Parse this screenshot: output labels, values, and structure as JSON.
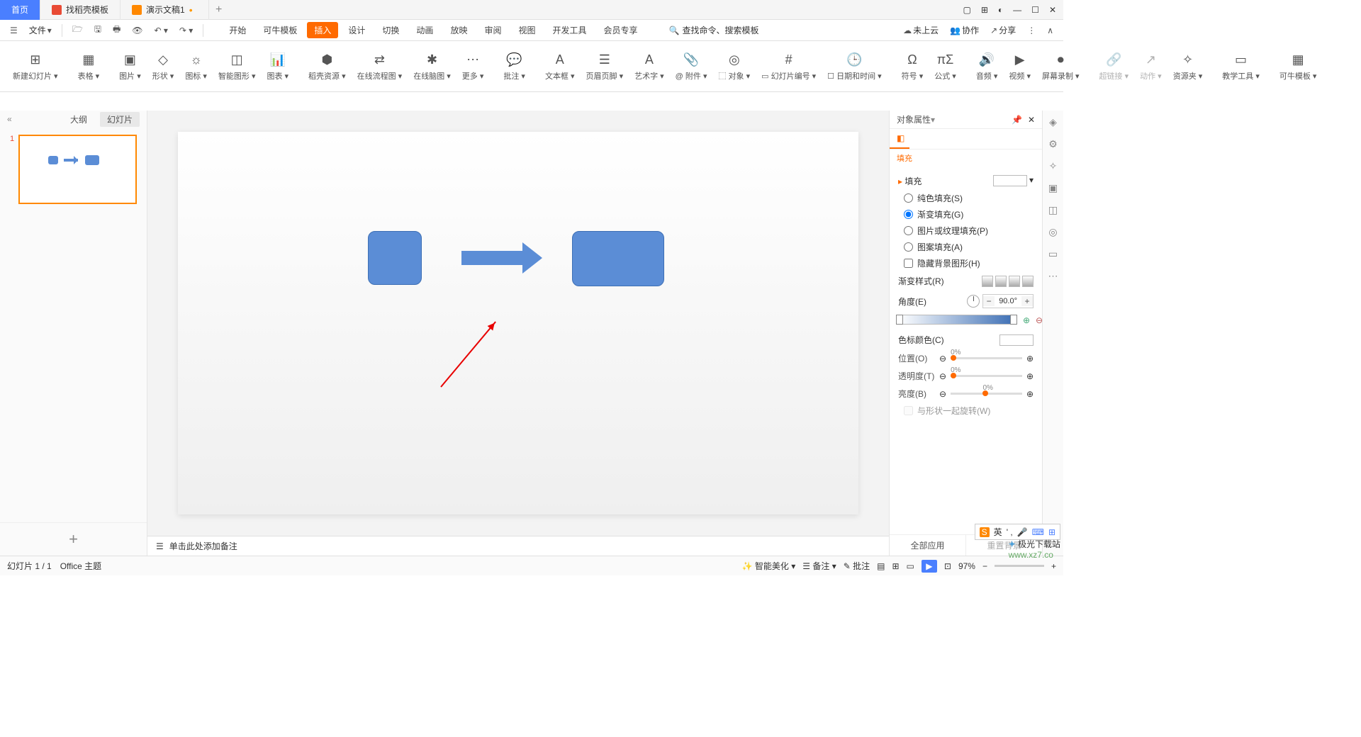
{
  "tabs": {
    "home": "首页",
    "templates": "找稻壳模板",
    "doc": "演示文稿1"
  },
  "topbar": {
    "file": "文件"
  },
  "menu": [
    "开始",
    "可牛模板",
    "插入",
    "设计",
    "切换",
    "动画",
    "放映",
    "审阅",
    "视图",
    "开发工具",
    "会员专享"
  ],
  "menu_active_index": 2,
  "search_placeholder": "查找命令、搜索模板",
  "ribbon": [
    {
      "label": "新建幻灯片",
      "icon": "⊞"
    },
    {
      "label": "表格",
      "icon": "▦"
    },
    {
      "label": "图片",
      "icon": "▣"
    },
    {
      "label": "形状",
      "icon": "◇"
    },
    {
      "label": "图标",
      "icon": "☼"
    },
    {
      "label": "智能图形",
      "icon": "◫"
    },
    {
      "label": "图表",
      "icon": "📊"
    },
    {
      "label": "稻壳资源",
      "icon": "⬢"
    },
    {
      "label": "在线流程图",
      "icon": "⇄"
    },
    {
      "label": "在线脑图",
      "icon": "✱"
    },
    {
      "label": "更多",
      "icon": "⋯"
    },
    {
      "label": "批注",
      "icon": "💬"
    },
    {
      "label": "文本框",
      "icon": "A"
    },
    {
      "label": "页眉页脚",
      "icon": "☰"
    },
    {
      "label": "艺术字",
      "icon": "A"
    },
    {
      "label": "附件",
      "icon": "📎",
      "prefix": "@"
    },
    {
      "label": "对象",
      "icon": "◎",
      "prefix": "⬚"
    },
    {
      "label": "幻灯片编号",
      "icon": "#",
      "prefix": "▭"
    },
    {
      "label": "日期和时间",
      "icon": "🕒",
      "prefix": "☐"
    },
    {
      "label": "符号",
      "icon": "Ω"
    },
    {
      "label": "公式",
      "icon": "πΣ"
    },
    {
      "label": "音频",
      "icon": "🔊"
    },
    {
      "label": "视频",
      "icon": "▶"
    },
    {
      "label": "屏幕录制",
      "icon": "⏺"
    },
    {
      "label": "超链接",
      "icon": "🔗",
      "disabled": true
    },
    {
      "label": "动作",
      "icon": "↗",
      "disabled": true
    },
    {
      "label": "资源夹",
      "icon": "✧"
    },
    {
      "label": "教学工具",
      "icon": "▭"
    },
    {
      "label": "可牛模板",
      "icon": "▦",
      "accent": true
    }
  ],
  "cloud": {
    "not_uploaded": "未上云",
    "coop": "协作",
    "share": "分享"
  },
  "slidetabs": {
    "outline": "大纲",
    "slides": "幻灯片"
  },
  "notes_placeholder": "单击此处添加备注",
  "prop": {
    "title": "对象属性",
    "tab_fill": "填充",
    "section": "填充",
    "opts": {
      "solid": "纯色填充(S)",
      "gradient": "渐变填充(G)",
      "picture": "图片或纹理填充(P)",
      "pattern": "图案填充(A)",
      "hidebg": "隐藏背景图形(H)"
    },
    "grad_style": "渐变样式(R)",
    "angle": "角度(E)",
    "angle_val": "90.0°",
    "stop_color": "色标颜色(C)",
    "position": "位置(O)",
    "pos_val": "0%",
    "transparency": "透明度(T)",
    "trans_val": "0%",
    "brightness": "亮度(B)",
    "bright_val": "0%",
    "rotate_with": "与形状一起旋转(W)",
    "apply_all": "全部应用",
    "reset_bg": "重置背景"
  },
  "status": {
    "slide": "幻灯片 1 / 1",
    "theme": "Office 主题",
    "beautify": "智能美化",
    "notes": "备注",
    "annotate": "批注",
    "zoom": "97%"
  },
  "ime": {
    "lang": "英"
  },
  "watermark": {
    "site": "极光下载站",
    "url": "www.xz7.co"
  }
}
